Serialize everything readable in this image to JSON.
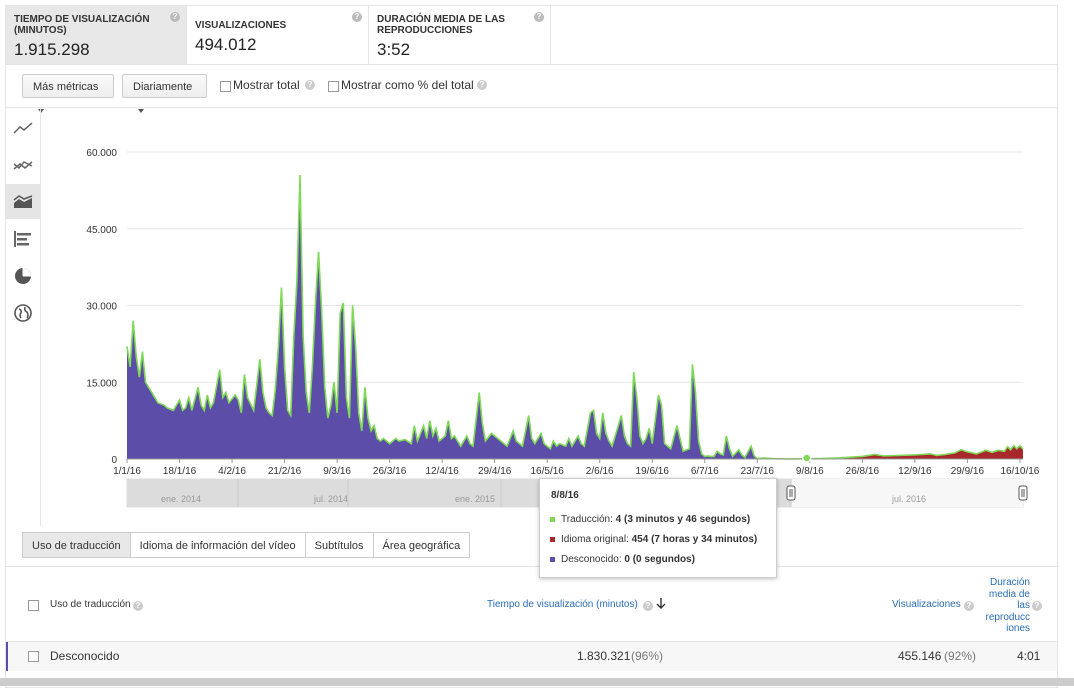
{
  "metrics": [
    {
      "label": "TIEMPO DE VISUALIZACIÓN (MINUTOS)",
      "value": "1.915.298"
    },
    {
      "label": "VISUALIZACIONES",
      "value": "494.012"
    },
    {
      "label": "DURACIÓN MEDIA DE LAS REPRODUCCIONES",
      "value": "3:52"
    }
  ],
  "toolbar": {
    "more_metrics": "Más métricas",
    "granularity": "Diariamente",
    "show_total": "Mostrar total",
    "show_percent": "Mostrar como % del total"
  },
  "chart_data": {
    "type": "area",
    "stacked": true,
    "y_ticks": [
      "60.000",
      "45.000",
      "30.000",
      "15.000",
      "0"
    ],
    "ylim": [
      0,
      60000
    ],
    "x_tick_labels": [
      "1/1/16",
      "18/1/16",
      "4/2/16",
      "21/2/16",
      "9/3/16",
      "26/3/16",
      "12/4/16",
      "29/4/16",
      "16/5/16",
      "2/6/16",
      "19/6/16",
      "6/7/16",
      "23/7/16",
      "9/8/16",
      "26/8/16",
      "12/9/16",
      "29/9/16",
      "16/10/16"
    ],
    "x_tick_days": [
      0,
      17,
      34,
      51,
      68,
      85,
      102,
      119,
      136,
      153,
      170,
      187,
      204,
      221,
      238,
      255,
      272,
      289
    ],
    "x_domain_days": [
      0,
      290
    ],
    "series": [
      {
        "name": "Desconocido",
        "color": "#5b4da8",
        "points": [
          [
            0,
            22000
          ],
          [
            1,
            18000
          ],
          [
            2,
            27000
          ],
          [
            3,
            20000
          ],
          [
            4,
            16000
          ],
          [
            5,
            21000
          ],
          [
            6,
            15000
          ],
          [
            8,
            13000
          ],
          [
            10,
            11000
          ],
          [
            12,
            10500
          ],
          [
            13,
            10000
          ],
          [
            15,
            9500
          ],
          [
            17,
            11500
          ],
          [
            18,
            9500
          ],
          [
            19,
            10000
          ],
          [
            20,
            12000
          ],
          [
            21,
            9500
          ],
          [
            23,
            14000
          ],
          [
            24,
            10500
          ],
          [
            25,
            9500
          ],
          [
            26,
            12500
          ],
          [
            27,
            10000
          ],
          [
            28,
            11000
          ],
          [
            30,
            17500
          ],
          [
            31,
            12000
          ],
          [
            32,
            13000
          ],
          [
            33,
            11000
          ],
          [
            35,
            12500
          ],
          [
            36,
            11500
          ],
          [
            37,
            9000
          ],
          [
            38,
            16500
          ],
          [
            39,
            12000
          ],
          [
            41,
            9500
          ],
          [
            43,
            19500
          ],
          [
            44,
            13000
          ],
          [
            45,
            10000
          ],
          [
            46,
            9000
          ],
          [
            47,
            8500
          ],
          [
            48,
            13500
          ],
          [
            49,
            22000
          ],
          [
            50,
            33500
          ],
          [
            51,
            18000
          ],
          [
            52,
            9500
          ],
          [
            53,
            8500
          ],
          [
            54,
            24000
          ],
          [
            55,
            35000
          ],
          [
            56,
            55500
          ],
          [
            57,
            24000
          ],
          [
            58,
            13000
          ],
          [
            59,
            9000
          ],
          [
            60,
            18000
          ],
          [
            61,
            30500
          ],
          [
            62,
            40500
          ],
          [
            63,
            29000
          ],
          [
            64,
            14000
          ],
          [
            65,
            8000
          ],
          [
            66,
            10500
          ],
          [
            67,
            15000
          ],
          [
            68,
            9000
          ],
          [
            69,
            28500
          ],
          [
            70,
            30500
          ],
          [
            71,
            12000
          ],
          [
            72,
            8000
          ],
          [
            73,
            30000
          ],
          [
            74,
            22000
          ],
          [
            75,
            9000
          ],
          [
            76,
            5500
          ],
          [
            77,
            14000
          ],
          [
            78,
            8000
          ],
          [
            79,
            5500
          ],
          [
            80,
            6500
          ],
          [
            81,
            4000
          ],
          [
            82,
            3500
          ],
          [
            83,
            4000
          ],
          [
            85,
            3000
          ],
          [
            87,
            4000
          ],
          [
            88,
            3500
          ],
          [
            90,
            3800
          ],
          [
            92,
            3000
          ],
          [
            93,
            6500
          ],
          [
            94,
            3500
          ],
          [
            96,
            6500
          ],
          [
            97,
            4000
          ],
          [
            98,
            7500
          ],
          [
            99,
            4500
          ],
          [
            100,
            6000
          ],
          [
            101,
            3500
          ],
          [
            103,
            4500
          ],
          [
            104,
            7500
          ],
          [
            105,
            4000
          ],
          [
            106,
            4500
          ],
          [
            107,
            3500
          ],
          [
            108,
            2500
          ],
          [
            110,
            4500
          ],
          [
            111,
            3000
          ],
          [
            112,
            2500
          ],
          [
            114,
            13000
          ],
          [
            115,
            7000
          ],
          [
            116,
            3500
          ],
          [
            118,
            5000
          ],
          [
            119,
            4500
          ],
          [
            120,
            4000
          ],
          [
            122,
            3000
          ],
          [
            123,
            2500
          ],
          [
            125,
            5500
          ],
          [
            126,
            3500
          ],
          [
            127,
            3000
          ],
          [
            128,
            2500
          ],
          [
            130,
            8500
          ],
          [
            131,
            4000
          ],
          [
            132,
            3000
          ],
          [
            134,
            5000
          ],
          [
            135,
            3000
          ],
          [
            136,
            2500
          ],
          [
            137,
            2000
          ],
          [
            138,
            3500
          ],
          [
            139,
            2500
          ],
          [
            140,
            3000
          ],
          [
            142,
            2500
          ],
          [
            143,
            4000
          ],
          [
            144,
            2500
          ],
          [
            146,
            4500
          ],
          [
            147,
            3000
          ],
          [
            148,
            2500
          ],
          [
            150,
            9000
          ],
          [
            151,
            9500
          ],
          [
            152,
            5000
          ],
          [
            153,
            4000
          ],
          [
            154,
            9000
          ],
          [
            155,
            5000
          ],
          [
            156,
            3500
          ],
          [
            157,
            2500
          ],
          [
            159,
            6500
          ],
          [
            160,
            8500
          ],
          [
            161,
            4500
          ],
          [
            162,
            3000
          ],
          [
            163,
            2500
          ],
          [
            164,
            17000
          ],
          [
            165,
            12000
          ],
          [
            166,
            4500
          ],
          [
            167,
            3000
          ],
          [
            168,
            4000
          ],
          [
            169,
            6000
          ],
          [
            170,
            3000
          ],
          [
            172,
            12500
          ],
          [
            173,
            10500
          ],
          [
            174,
            3000
          ],
          [
            176,
            2000
          ],
          [
            178,
            6500
          ],
          [
            179,
            4000
          ],
          [
            180,
            1500
          ],
          [
            182,
            2000
          ],
          [
            183,
            18500
          ],
          [
            184,
            13000
          ],
          [
            185,
            3500
          ],
          [
            186,
            1000
          ],
          [
            187,
            500
          ],
          [
            188,
            600
          ],
          [
            189,
            500
          ],
          [
            190,
            500
          ],
          [
            191,
            1500
          ],
          [
            192,
            1000
          ],
          [
            193,
            800
          ],
          [
            194,
            4500
          ],
          [
            195,
            2000
          ],
          [
            196,
            500
          ],
          [
            198,
            1800
          ],
          [
            199,
            800
          ],
          [
            200,
            300
          ],
          [
            202,
            2500
          ],
          [
            203,
            600
          ],
          [
            204,
            100
          ],
          [
            206,
            200
          ],
          [
            210,
            50
          ],
          [
            215,
            0
          ],
          [
            290,
            0
          ]
        ]
      },
      {
        "name": "Idioma original",
        "color": "#a8282b",
        "points": [
          [
            0,
            0
          ],
          [
            215,
            0
          ],
          [
            225,
            100
          ],
          [
            230,
            200
          ],
          [
            238,
            500
          ],
          [
            242,
            900
          ],
          [
            245,
            600
          ],
          [
            250,
            700
          ],
          [
            255,
            800
          ],
          [
            260,
            1000
          ],
          [
            262,
            700
          ],
          [
            265,
            900
          ],
          [
            268,
            1200
          ],
          [
            270,
            1800
          ],
          [
            272,
            1400
          ],
          [
            275,
            1000
          ],
          [
            278,
            1700
          ],
          [
            280,
            1300
          ],
          [
            282,
            1700
          ],
          [
            284,
            1500
          ],
          [
            285,
            2400
          ],
          [
            286,
            1800
          ],
          [
            287,
            2600
          ],
          [
            288,
            2000
          ],
          [
            289,
            2600
          ],
          [
            290,
            1900
          ]
        ]
      },
      {
        "name": "Traducción",
        "color": "#7ed957",
        "points": [
          [
            0,
            0
          ],
          [
            200,
            0
          ],
          [
            210,
            0
          ],
          [
            215,
            0
          ],
          [
            290,
            0
          ]
        ]
      }
    ]
  },
  "overview": {
    "labels": [
      "ene. 2014",
      "jul. 2014",
      "ene. 2015",
      "jul. 2016"
    ]
  },
  "tooltip": {
    "date": "8/8/16",
    "lines": [
      {
        "series": "Traducción",
        "value": "4 (3 minutos y 46 segundos)",
        "color": "#7ed957"
      },
      {
        "series": "Idioma original",
        "value": "454 (7 horas y 34 minutos)",
        "color": "#a8282b"
      },
      {
        "series": "Desconocido",
        "value": "0 (0 segundos)",
        "color": "#5b4da8"
      }
    ]
  },
  "tabs": [
    "Uso de traducción",
    "Idioma de información del vídeo",
    "Subtítulos",
    "Área geográfica"
  ],
  "table": {
    "headers": {
      "dimension": "Uso de traducción",
      "watch_time": "Tiempo de visualización (minutos)",
      "views": "Visualizaciones",
      "avg_duration_lines": [
        "Duración",
        "media de",
        "las",
        "reproducc",
        "iones"
      ]
    },
    "rows": [
      {
        "name": "Desconocido",
        "watch_time": "1.830.321",
        "watch_pct": "(96%)",
        "views": "455.146",
        "views_pct": "(92%)",
        "avg": "4:01"
      }
    ]
  }
}
